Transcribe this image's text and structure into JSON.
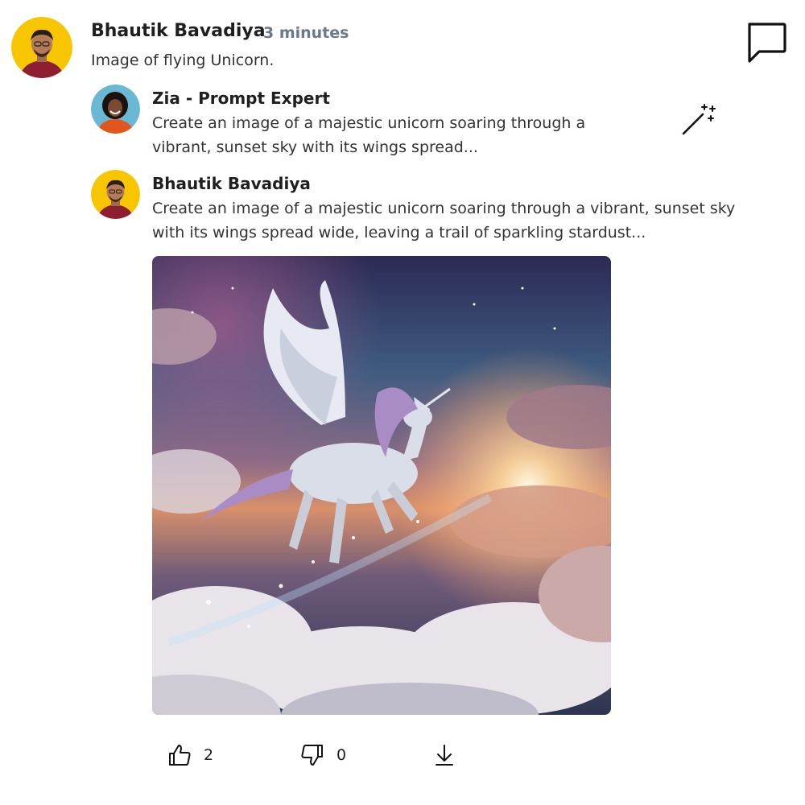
{
  "post": {
    "author": "Bhautik Bavadiya",
    "timestamp": "3 minutes",
    "text": "Image of flying Unicorn."
  },
  "prompt_expert": {
    "name": "Zia - Prompt Expert",
    "text": "Create an image of a majestic unicorn soaring through a vibrant, sunset sky with its wings spread..."
  },
  "reply": {
    "author": "Bhautik Bavadiya",
    "text": "Create an image of a majestic unicorn soaring through a vibrant, sunset sky with its wings spread wide, leaving a trail of sparkling stardust..."
  },
  "actions": {
    "likes": "2",
    "dislikes": "0"
  },
  "icons": {
    "comment": "comment-icon",
    "wand": "magic-wand-icon",
    "like": "thumbs-up-icon",
    "dislike": "thumbs-down-icon",
    "download": "download-icon"
  },
  "colors": {
    "avatar_bg": "#f7c600",
    "timestamp": "#6b7a8a",
    "text": "#1f1f1f"
  }
}
